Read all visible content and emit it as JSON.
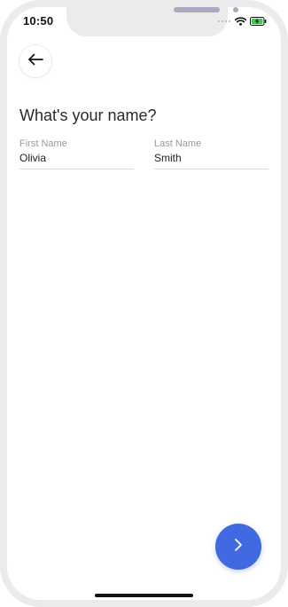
{
  "status_bar": {
    "time": "10:50"
  },
  "icons": {
    "back": "arrow-left-icon",
    "next": "chevron-right-icon",
    "wifi": "wifi-icon",
    "battery": "battery-charging-icon"
  },
  "page": {
    "title": "What's your name?"
  },
  "form": {
    "first_name": {
      "label": "First Name",
      "value": "Olivia"
    },
    "last_name": {
      "label": "Last Name",
      "value": "Smith"
    }
  },
  "colors": {
    "accent": "#4169e1",
    "battery_charge": "#3ccb4a",
    "device_frame": "#ebebeb"
  }
}
